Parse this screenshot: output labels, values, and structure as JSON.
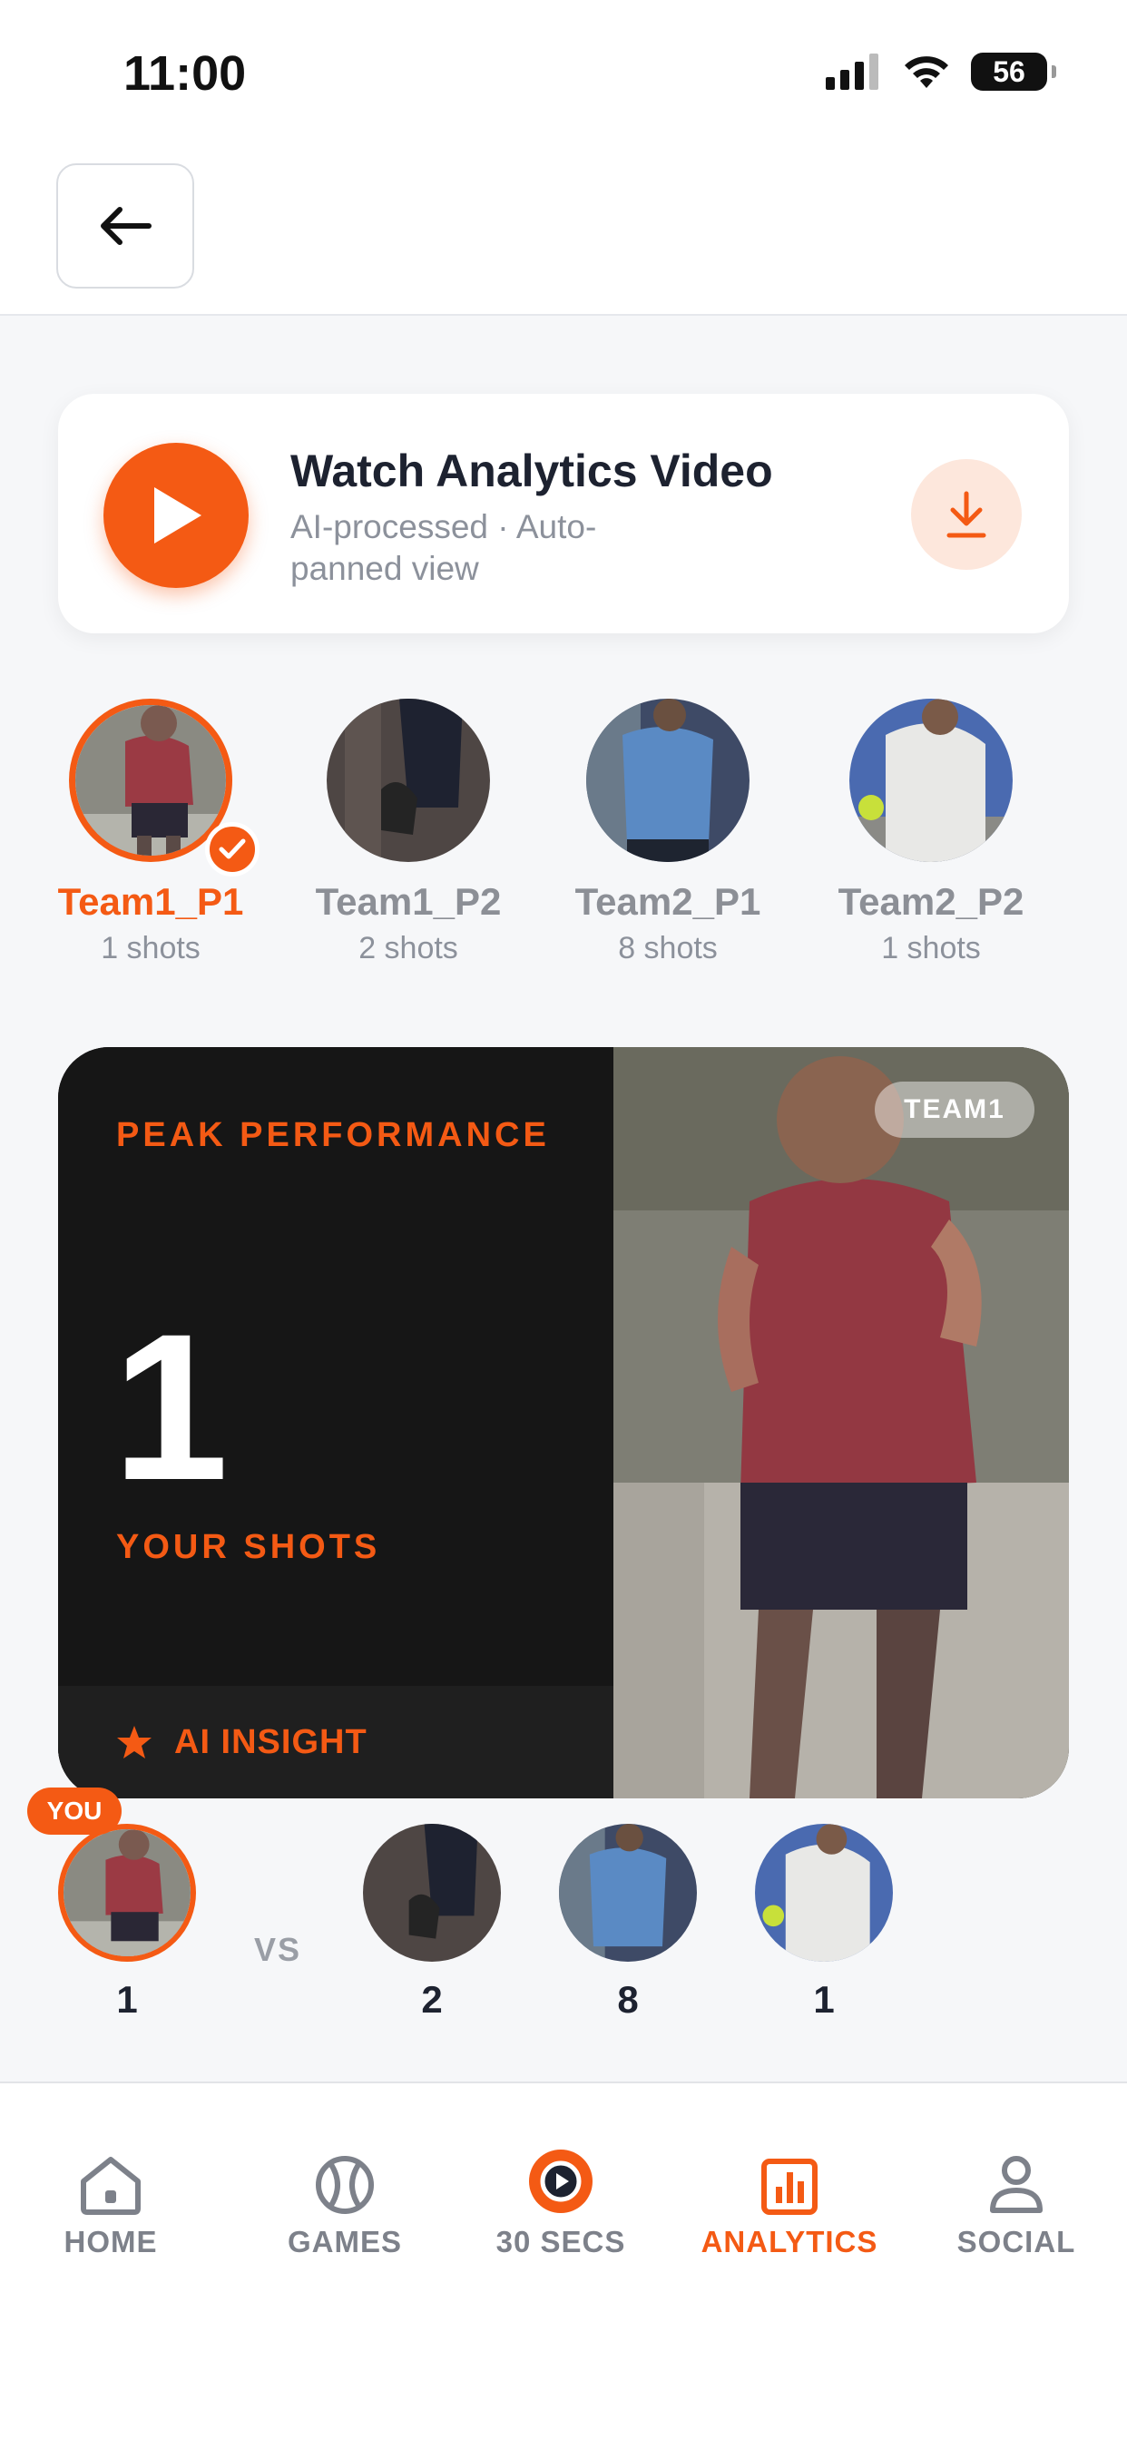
{
  "status_bar": {
    "time": "11:00",
    "battery": "56"
  },
  "video_card": {
    "title": "Watch Analytics Video",
    "subtitle": "AI-processed · Auto-panned view"
  },
  "players": [
    {
      "name": "Team1_P1",
      "shots": "1 shots",
      "selected": true
    },
    {
      "name": "Team1_P2",
      "shots": "2 shots",
      "selected": false
    },
    {
      "name": "Team2_P1",
      "shots": "8 shots",
      "selected": false
    },
    {
      "name": "Team2_P2",
      "shots": "1 shots",
      "selected": false
    }
  ],
  "peak_card": {
    "label": "PEAK PERFORMANCE",
    "value": "1",
    "value_label": "YOUR SHOTS",
    "insight_label": "AI INSIGHT",
    "team_badge": "TEAM1"
  },
  "comparison": {
    "you_badge": "YOU",
    "vs_label": "VS",
    "counts": [
      "1",
      "2",
      "8",
      "1"
    ]
  },
  "tab_bar": {
    "tabs": [
      {
        "label": "HOME",
        "icon": "home-icon"
      },
      {
        "label": "GAMES",
        "icon": "tennis-ball-icon"
      },
      {
        "label": "30 SECS",
        "icon": "play-clip-icon"
      },
      {
        "label": "ANALYTICS",
        "icon": "bar-chart-icon",
        "active": true
      },
      {
        "label": "SOCIAL",
        "icon": "person-icon"
      }
    ]
  },
  "colors": {
    "accent": "#f45a14",
    "card_dark": "#161616",
    "text_dark": "#1d2230",
    "muted": "#8c919b"
  }
}
